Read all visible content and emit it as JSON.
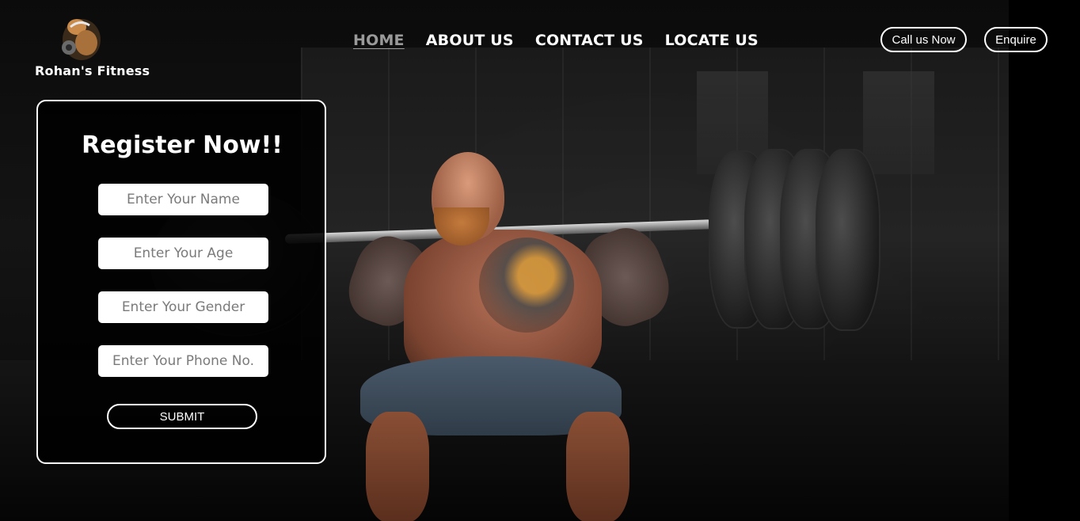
{
  "brand": {
    "name": "Rohan's Fitness",
    "logo_icon": "bodybuilder-icon"
  },
  "nav": {
    "items": [
      {
        "label": "HOME",
        "active": true
      },
      {
        "label": "ABOUT US",
        "active": false
      },
      {
        "label": "CONTACT US",
        "active": false
      },
      {
        "label": "LOCATE US",
        "active": false
      }
    ]
  },
  "header_actions": {
    "call_label": "Call us Now",
    "enquire_label": "Enquire"
  },
  "register_form": {
    "title": "Register Now!!",
    "fields": [
      {
        "placeholder": "Enter Your Name",
        "value": ""
      },
      {
        "placeholder": "Enter Your Age",
        "value": ""
      },
      {
        "placeholder": "Enter Your Gender",
        "value": ""
      },
      {
        "placeholder": "Enter Your Phone No.",
        "value": ""
      }
    ],
    "submit_label": "SUBMIT"
  },
  "colors": {
    "background": "#000000",
    "text": "#ffffff",
    "active_nav": "#9a9a9a",
    "input_bg": "#ffffff",
    "placeholder": "#7a7a7a"
  }
}
